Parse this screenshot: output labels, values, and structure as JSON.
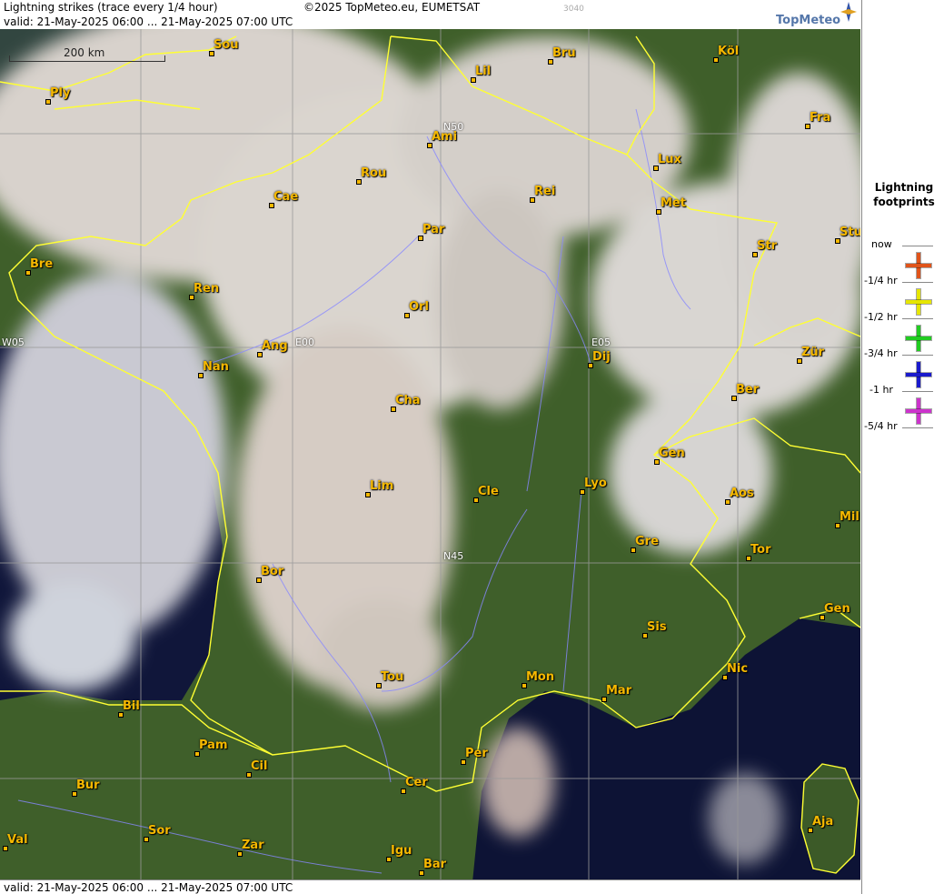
{
  "header": {
    "title": "Lightning strikes (trace every 1/4 hour)",
    "copyright": "©2025 TopMeteo.eu, EUMETSAT",
    "code": "3040",
    "valid": "valid:  21-May-2025 06:00 ... 21-May-2025 07:00 UTC"
  },
  "footer": {
    "valid": "valid:  21-May-2025 06:00 ... 21-May-2025 07:00 UTC"
  },
  "logo": {
    "text": "TopMeteo"
  },
  "scale": {
    "label": "200 km"
  },
  "grid_labels": {
    "n50": "N50",
    "n45": "N45",
    "e00": "E00",
    "e05": "E05",
    "w05": "W05"
  },
  "cities": {
    "sou": "Sou",
    "lil": "Lil",
    "bru": "Bru",
    "kol": "Köl",
    "ply": "Ply",
    "ami": "Ami",
    "fra": "Fra",
    "rou": "Rou",
    "lux": "Lux",
    "cae": "Cae",
    "rei": "Rei",
    "met": "Met",
    "par": "Par",
    "stu": "Stu",
    "str": "Str",
    "bre": "Bre",
    "ren": "Ren",
    "orl": "Orl",
    "ang": "Ang",
    "dij": "Dij",
    "zur": "Zür",
    "nan": "Nan",
    "ber": "Ber",
    "cha": "Cha",
    "gen1": "Gen",
    "lim": "Lim",
    "cle": "Cle",
    "lyo": "Lyo",
    "aos": "Aos",
    "mil": "Mil",
    "gre": "Gre",
    "tor": "Tor",
    "bor": "Bor",
    "gen2": "Gen",
    "sis": "Sis",
    "nic": "Nic",
    "tou": "Tou",
    "mon": "Mon",
    "mar": "Mar",
    "bil": "Bil",
    "pam": "Pam",
    "cil": "Cil",
    "per": "Per",
    "cer": "Cer",
    "bur": "Bur",
    "sor": "Sor",
    "aja": "Aja",
    "val": "Val",
    "zar": "Zar",
    "igu": "Igu",
    "bar": "Bar"
  },
  "legend": {
    "title": "Lightning footprints",
    "rows": [
      {
        "label": "now",
        "color": ""
      },
      {
        "label": "-1/4 hr",
        "color": "#e0541a"
      },
      {
        "label": "-1/2 hr",
        "color": "#e6e600"
      },
      {
        "label": "-3/4 hr",
        "color": "#22cc22"
      },
      {
        "label": "-1 hr",
        "color": "#1a1acc"
      },
      {
        "label": "-5/4 hr",
        "color": "#cc33cc"
      }
    ]
  },
  "colors": {
    "border": "#ffff33",
    "river": "#8888ff",
    "city": "#f5b800",
    "land": "#3f5f2a",
    "sea": "#10163a",
    "cloud": "#d9d3cc"
  }
}
